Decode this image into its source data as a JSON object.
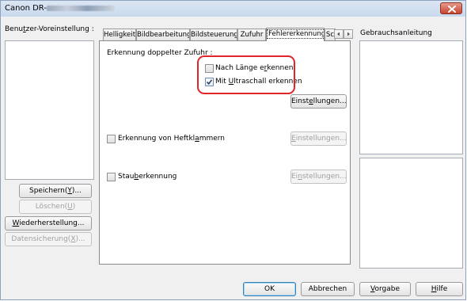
{
  "window": {
    "title": "Canon DR-",
    "close_label": "×"
  },
  "sidebar": {
    "preset_label": "Benutzer-Voreinstellung :",
    "save_button": "Speichern(Y)...",
    "delete_button": "Löschen(U)",
    "restore_button": "Wiederherstellung...",
    "backup_button": "Datensicherung(X)..."
  },
  "tabs": [
    {
      "label": "Helligkeit"
    },
    {
      "label": "Bildbearbeitung"
    },
    {
      "label": "Bildsteuerung"
    },
    {
      "label": "Zufuhr"
    },
    {
      "label": "Fehlererkennung"
    },
    {
      "label": "Sc"
    }
  ],
  "tab_scroll": {
    "left": "◂",
    "right": "▸"
  },
  "panel": {
    "double_feed_label": "Erkennung doppelter Zufuhr :",
    "by_length_label": "Nach Länge erkennen",
    "by_length_checked": false,
    "by_ultrasonic_label": "Mit Ultraschall erkennen",
    "by_ultrasonic_checked": true,
    "settings_button_1": "Einstellungen...",
    "staple_label": "Erkennung von Heftklammern",
    "staple_checked": false,
    "settings_button_2": "Einstellungen...",
    "jam_label": "Stauberkennung",
    "jam_checked": false,
    "settings_button_3": "Einstellungen..."
  },
  "help": {
    "label": "Gebrauchsanleitung"
  },
  "footer": {
    "ok": "OK",
    "cancel": "Abbrechen",
    "defaults": "Vorgabe",
    "help": "Hilfe"
  },
  "colors": {
    "highlight": "#e0242a",
    "titlebar": "#c9d9ee",
    "close": "#c6442e"
  }
}
